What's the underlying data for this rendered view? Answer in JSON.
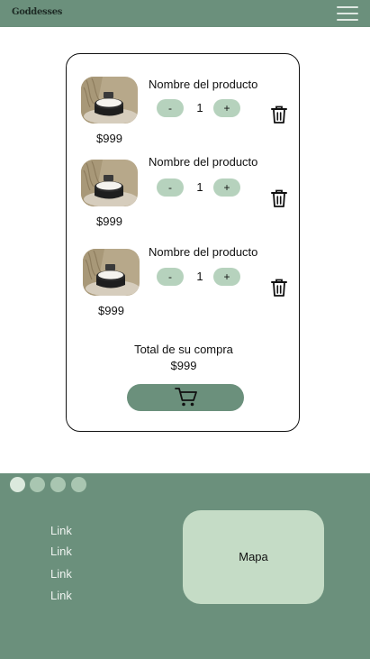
{
  "header": {
    "logo_text": "Goddesses",
    "menu_icon": "hamburger-menu-icon",
    "background": "#6b907c"
  },
  "cart": {
    "items": [
      {
        "name": "Nombre del producto",
        "price": "$999",
        "decrement_label": "-",
        "quantity": "1",
        "increment_label": "+",
        "image": "product-jar-image",
        "delete_icon": "trash-icon"
      },
      {
        "name": "Nombre del producto",
        "price": "$999",
        "decrement_label": "-",
        "quantity": "1",
        "increment_label": "+",
        "image": "product-jar-image",
        "delete_icon": "trash-icon"
      },
      {
        "name": "Nombre del producto",
        "price": "$999",
        "decrement_label": "-",
        "quantity": "1",
        "increment_label": "+",
        "image": "product-jar-image",
        "delete_icon": "trash-icon"
      }
    ],
    "total_label": "Total de su compra",
    "total_value": "$999",
    "checkout_icon": "shopping-cart-icon",
    "accent": "#b6d2bd"
  },
  "footer": {
    "social_icons": [
      "social-icon",
      "social-icon",
      "social-icon",
      "social-icon"
    ],
    "links": [
      "Link",
      "Link",
      "Link",
      "Link"
    ],
    "map_label": "Mapa",
    "background": "#6b907c",
    "map_color": "#c5dcc6"
  }
}
